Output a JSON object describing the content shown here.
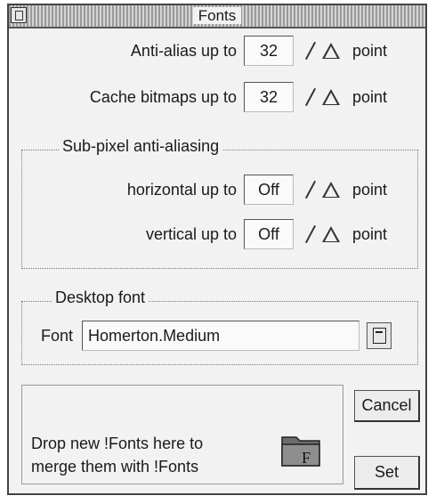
{
  "window": {
    "title": "Fonts"
  },
  "antialias": {
    "label": "Anti-alias up to",
    "value": "32",
    "unit": "point"
  },
  "cache": {
    "label": "Cache bitmaps up to",
    "value": "32",
    "unit": "point"
  },
  "subpixel": {
    "title": "Sub-pixel anti-aliasing",
    "horizontal": {
      "label": "horizontal up to",
      "value": "Off",
      "unit": "point"
    },
    "vertical": {
      "label": "vertical up to",
      "value": "Off",
      "unit": "point"
    }
  },
  "desktop": {
    "title": "Desktop font",
    "font_label": "Font",
    "font_value": "Homerton.Medium"
  },
  "drop": {
    "line1": "Drop new !Fonts here to",
    "line2": "merge them with !Fonts",
    "icon_letter": "F"
  },
  "buttons": {
    "cancel": "Cancel",
    "set": "Set"
  },
  "icons": {
    "close": "close-icon",
    "adjust": "adjust-arrows-icon",
    "menu": "menu-icon",
    "folder": "fonts-folder-icon"
  }
}
